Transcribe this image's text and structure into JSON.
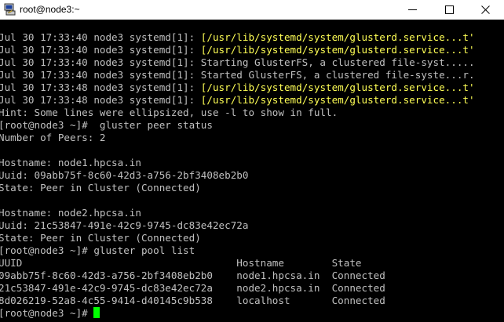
{
  "window": {
    "title": "root@node3:~",
    "icon": "putty-icon"
  },
  "controls": {
    "minimize": "minimize-icon",
    "maximize": "maximize-icon",
    "close": "close-icon"
  },
  "colors": {
    "background": "#000000",
    "text": "#c0c0c0",
    "highlight": "#ffff55",
    "cursor": "#00ff00"
  },
  "lines": [
    {
      "a": "Jul 30 17:33:40 node3 systemd[1]: ",
      "b": "[/usr/lib/systemd/system/glusterd.service...t'"
    },
    {
      "a": "Jul 30 17:33:40 node3 systemd[1]: ",
      "b": "[/usr/lib/systemd/system/glusterd.service...t'"
    },
    {
      "a": "Jul 30 17:33:40 node3 systemd[1]: Starting GlusterFS, a clustered file-syst.....",
      "b": ""
    },
    {
      "a": "Jul 30 17:33:40 node3 systemd[1]: Started GlusterFS, a clustered file-syste...r.",
      "b": ""
    },
    {
      "a": "Jul 30 17:33:48 node3 systemd[1]: ",
      "b": "[/usr/lib/systemd/system/glusterd.service...t'"
    },
    {
      "a": "Jul 30 17:33:48 node3 systemd[1]: ",
      "b": "[/usr/lib/systemd/system/glusterd.service...t'"
    },
    {
      "a": "Hint: Some lines were ellipsized, use -l to show in full.",
      "b": ""
    },
    {
      "a": "[root@node3 ~]#  gluster peer status",
      "b": ""
    },
    {
      "a": "Number of Peers: 2",
      "b": ""
    },
    {
      "a": "",
      "b": ""
    },
    {
      "a": "Hostname: node1.hpcsa.in",
      "b": ""
    },
    {
      "a": "Uuid: 09abb75f-8c60-42d3-a756-2bf3408eb2b0",
      "b": ""
    },
    {
      "a": "State: Peer in Cluster (Connected)",
      "b": ""
    },
    {
      "a": "",
      "b": ""
    },
    {
      "a": "Hostname: node2.hpcsa.in",
      "b": ""
    },
    {
      "a": "Uuid: 21c53847-491e-42c9-9745-dc83e42ec72a",
      "b": ""
    },
    {
      "a": "State: Peer in Cluster (Connected)",
      "b": ""
    },
    {
      "a": "[root@node3 ~]# gluster pool list",
      "b": ""
    },
    {
      "a": "UUID                                    Hostname        State",
      "b": ""
    },
    {
      "a": "09abb75f-8c60-42d3-a756-2bf3408eb2b0    node1.hpcsa.in  Connected",
      "b": ""
    },
    {
      "a": "21c53847-491e-42c9-9745-dc83e42ec72a    node2.hpcsa.in  Connected",
      "b": ""
    },
    {
      "a": "8d026219-52a8-4c55-9414-d40145c9b538    localhost       Connected",
      "b": ""
    },
    {
      "a": "[root@node3 ~]# ",
      "b": ""
    }
  ]
}
